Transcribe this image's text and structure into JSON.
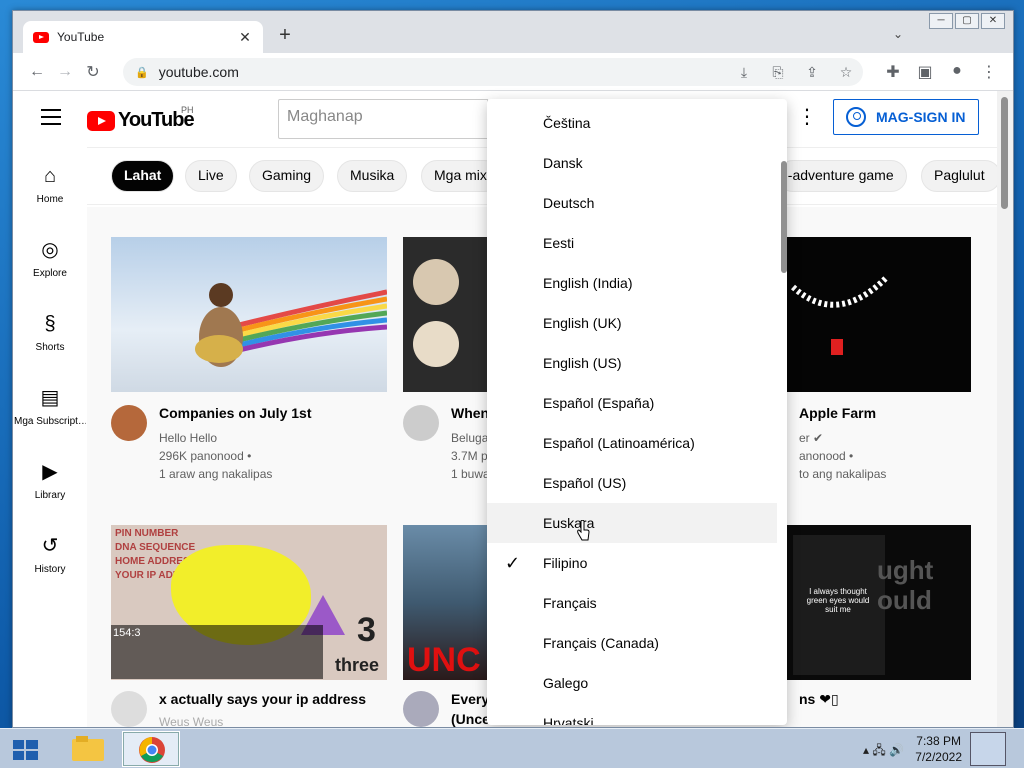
{
  "browser": {
    "tab_title": "YouTube",
    "tab_close": "✕",
    "new_tab": "+",
    "url": "youtube.com",
    "window_buttons": [
      "─",
      "▢",
      "✕"
    ],
    "icons": [
      "back-arrow-icon",
      "forward-arrow-icon",
      "reload-icon",
      "lock-icon",
      "install-icon",
      "translate-icon",
      "share-icon",
      "star-icon",
      "extensions-icon",
      "sidepanel-icon",
      "profile-icon",
      "kebab-menu-icon"
    ]
  },
  "youtube": {
    "logo_text": "YouTube",
    "country_code": "PH",
    "search_placeholder": "Maghanap",
    "signin_label": "MAG-SIGN IN",
    "sidebar": [
      {
        "label": "Home",
        "icon": "⌂"
      },
      {
        "label": "Explore",
        "icon": "◎"
      },
      {
        "label": "Shorts",
        "icon": "§"
      },
      {
        "label": "Mga Subscript…",
        "icon": "▤"
      },
      {
        "label": "Library",
        "icon": "▶"
      },
      {
        "label": "History",
        "icon": "↺"
      }
    ],
    "chips": [
      "Lahat",
      "Live",
      "Gaming",
      "Musika",
      "Mga mix",
      "n-adventure game",
      "Paglulut"
    ],
    "videos": [
      {
        "title": "Companies on July 1st",
        "channel": "Hello Hello",
        "views": "296K panonood •",
        "age": "1 araw ang nakalipas"
      },
      {
        "title": "When",
        "channel": "Beluga",
        "views": "3.7M p",
        "age": "1 buwa"
      },
      {
        "title": "Apple Farm",
        "channel": "er ✔",
        "views": "anonood •",
        "age": "to ang nakalipas"
      },
      {
        "title": "x actually says your ip address",
        "channel": "Weus Weus",
        "views": "",
        "age": "",
        "duration": "154:3"
      },
      {
        "title": "Every",
        "title2": "(Unce",
        "channel": "",
        "views": "",
        "age": ""
      },
      {
        "title": "ns ❤▯",
        "channel": "",
        "views": "",
        "age": ""
      }
    ],
    "thumb_text": {
      "ip_lines": [
        "PIN NUMBER",
        "DNA SEQUENCE",
        "HOME ADDRESS",
        "YOUR IP ADDRESS"
      ],
      "ip_number": "3",
      "ip_word": "three",
      "unce": "UNC",
      "ought": "ught\nould",
      "ought_small": "I always thought green eyes would suit me"
    }
  },
  "language_menu": {
    "items": [
      "Čeština",
      "Dansk",
      "Deutsch",
      "Eesti",
      "English (India)",
      "English (UK)",
      "English (US)",
      "Español (España)",
      "Español (Latinoamérica)",
      "Español (US)",
      "Euskara",
      "Filipino",
      "Français",
      "Français (Canada)",
      "Galego",
      "Hrvatski"
    ],
    "selected": "Filipino",
    "hovered": "Euskara",
    "check_glyph": "✓"
  },
  "taskbar": {
    "time": "7:38 PM",
    "date": "7/2/2022",
    "tray_icons": "▴ 🖧 🔊"
  },
  "colors": {
    "youtube_red": "#ff0000",
    "link_blue": "#065fd4",
    "chip_active": "#030303"
  }
}
